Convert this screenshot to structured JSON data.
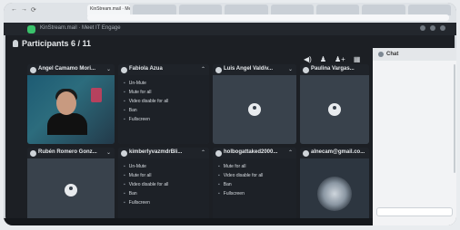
{
  "browser": {
    "tabs": [
      "KinStream.mail · Meet IT Engage",
      "",
      "",
      "",
      "",
      "",
      "",
      ""
    ],
    "nav": [
      "←",
      "→",
      "⟳"
    ]
  },
  "app": {
    "title": "KinStream.mail · Meet IT Engage"
  },
  "participants": {
    "label": "Participants 6 / 11"
  },
  "toolbar_icons": [
    "speaker-icon",
    "people-icon",
    "people-add-icon",
    "grid-icon"
  ],
  "tiles": [
    {
      "name": "Angel Camamo Mori...",
      "sub": "",
      "kind": "video"
    },
    {
      "name": "Fabiola Azua",
      "sub": "",
      "kind": "menu"
    },
    {
      "name": "Luis Angel Valdiv...",
      "sub": "",
      "kind": "avatar"
    },
    {
      "name": "Paulina Vargas...",
      "sub": "",
      "kind": "avatar"
    },
    {
      "name": "Rubén Romero Gonz...",
      "sub": "",
      "kind": "avatar"
    },
    {
      "name": "kimberlyvazmdrBli...",
      "sub": "",
      "kind": "menu"
    },
    {
      "name": "holbogattaked2000...",
      "sub": "",
      "kind": "menu2"
    },
    {
      "name": "alnecam@gmail.co...",
      "sub": "",
      "kind": "camera"
    }
  ],
  "menu_items": [
    "Un-Mute",
    "Mute for all",
    "Video disable for all",
    "Ban",
    "Fullscreen"
  ],
  "menu2_items": [
    "Mute for all",
    "Video disable for all",
    "Ban",
    "Fullscreen"
  ],
  "chat": {
    "title": "Chat",
    "messages": [
      {
        "name": "",
        "text": ""
      },
      {
        "name": "",
        "text": ""
      },
      {
        "name": "",
        "text": ""
      },
      {
        "name": "",
        "text": ""
      },
      {
        "name": "",
        "text": ""
      },
      {
        "name": "",
        "text": ""
      },
      {
        "name": "",
        "text": ""
      },
      {
        "name": "",
        "text": ""
      },
      {
        "name": "",
        "text": ""
      }
    ],
    "input_placeholder": ""
  }
}
